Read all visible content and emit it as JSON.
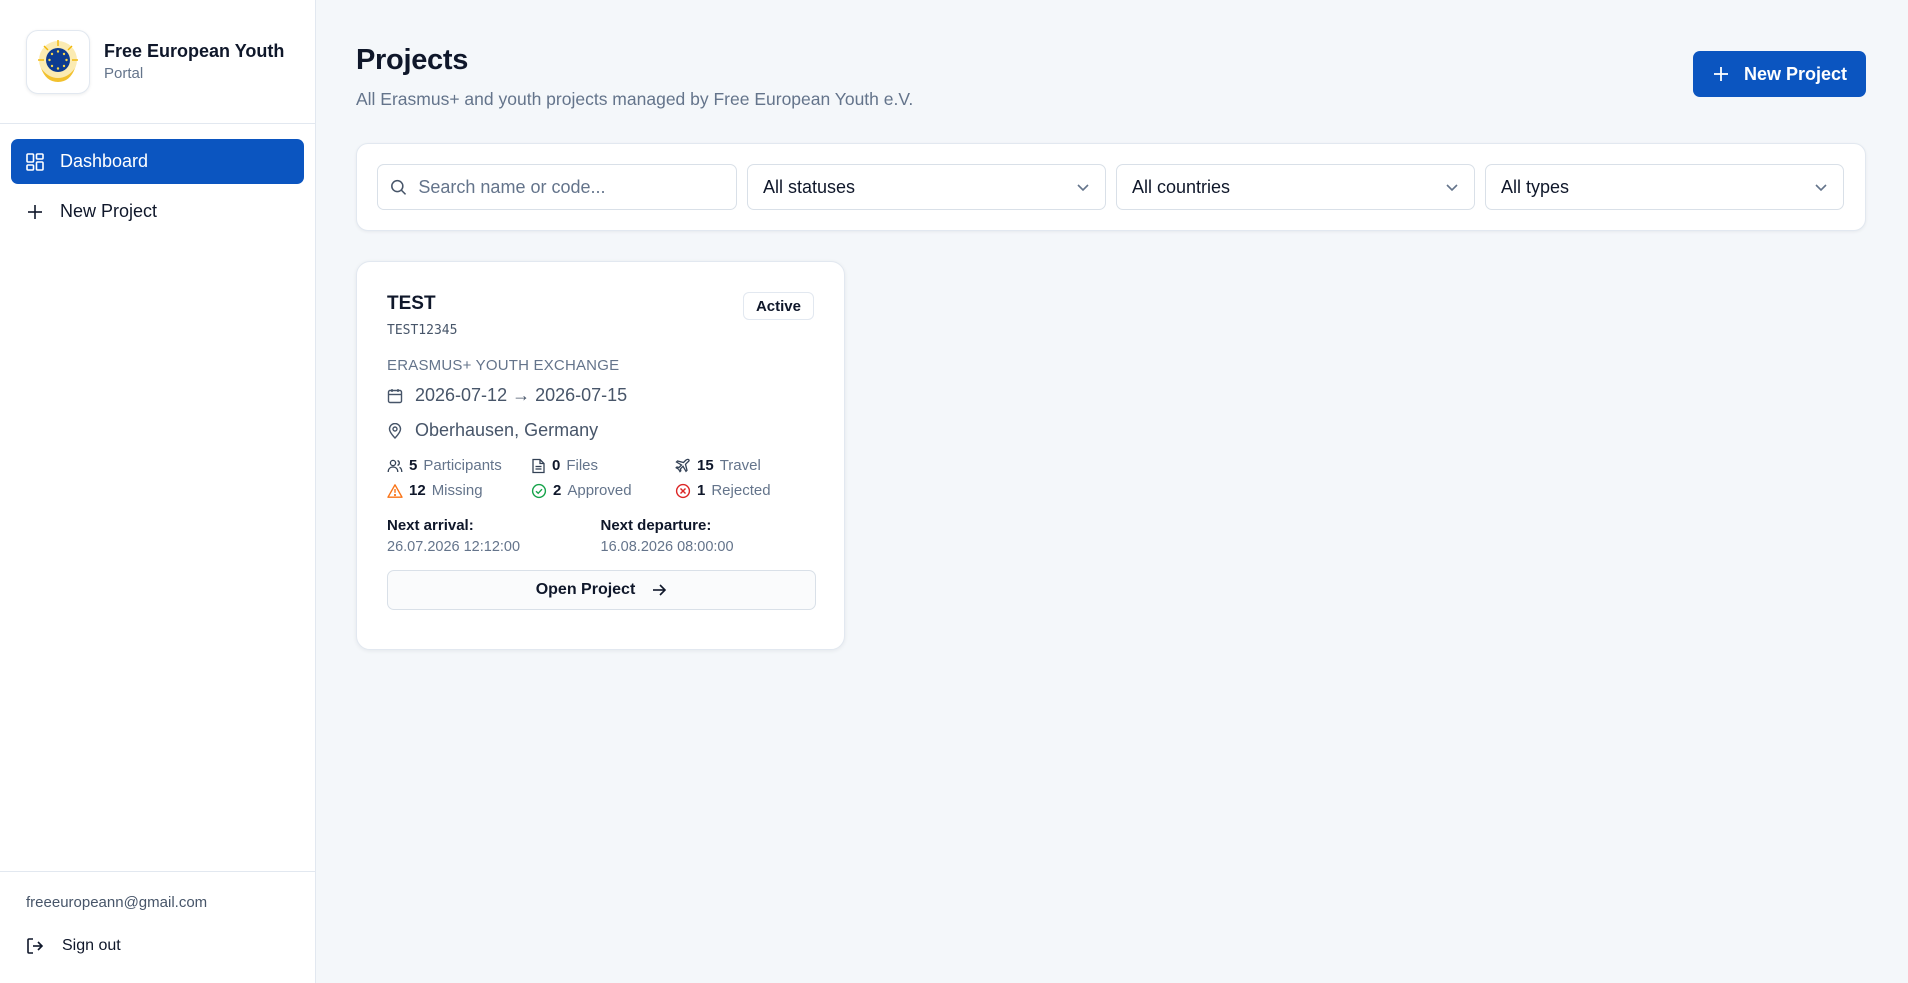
{
  "brand": {
    "name": "Free European Youth",
    "subtitle": "Portal"
  },
  "sidebar": {
    "items": [
      {
        "label": "Dashboard",
        "icon": "dashboard-grid-icon",
        "active": true
      },
      {
        "label": "New Project",
        "icon": "plus-icon",
        "active": false
      }
    ],
    "user_email": "freeeuropeann@gmail.com",
    "signout_label": "Sign out"
  },
  "header": {
    "title": "Projects",
    "subtitle": "All Erasmus+ and youth projects managed by Free European Youth e.V.",
    "new_project_label": "New Project"
  },
  "filters": {
    "search_placeholder": "Search name or code...",
    "status": "All statuses",
    "country": "All countries",
    "type": "All types"
  },
  "project": {
    "title": "TEST",
    "code": "TEST12345",
    "status": "Active",
    "type": "ERASMUS+ YOUTH EXCHANGE",
    "dates": "2026-07-12 → 2026-07-15",
    "location": "Oberhausen, Germany",
    "stats": {
      "participants": {
        "count": "5",
        "label": "Participants"
      },
      "files": {
        "count": "0",
        "label": "Files"
      },
      "travel": {
        "count": "15",
        "label": "Travel"
      },
      "missing": {
        "count": "12",
        "label": "Missing"
      },
      "approved": {
        "count": "2",
        "label": "Approved"
      },
      "rejected": {
        "count": "1",
        "label": "Rejected"
      }
    },
    "next_arrival_label": "Next arrival:",
    "next_arrival": "26.07.2026 12:12:00",
    "next_departure_label": "Next departure:",
    "next_departure": "16.08.2026 08:00:00",
    "open_label": "Open Project"
  },
  "colors": {
    "accent": "#0b55c0",
    "warning": "#f97316",
    "success": "#16a34a",
    "danger": "#dc2626"
  }
}
